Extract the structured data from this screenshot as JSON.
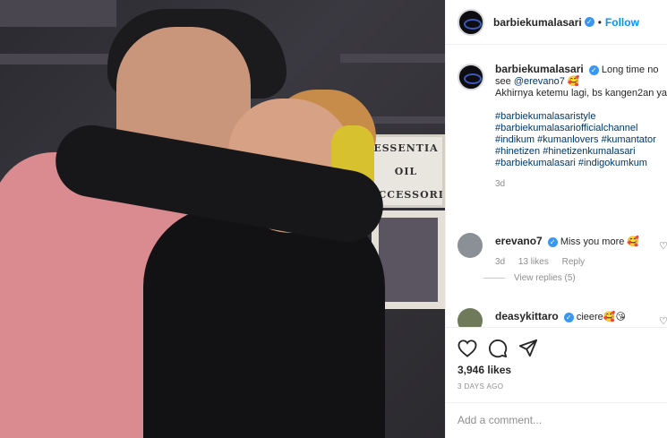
{
  "post": {
    "photo_sign_lines": [
      "ESSENTIA",
      "OIL",
      "ACCESSORI"
    ]
  },
  "header": {
    "username": "barbiekumalasari",
    "separator": "•",
    "follow_label": "Follow"
  },
  "caption": {
    "username": "barbiekumalasari",
    "text_line1": "Long time no see",
    "mention": "@erevano7",
    "emoji": "🥰",
    "text_line2": "Akhirnya ketemu lagi, bs kangen2an yaa",
    "hashtags": "#barbiekumalasaristyle #barbiekumalasariofficialchannel #indikum #kumanlovers #kumantator #hinetizen #hinetizenkumalasari #barbiekumalasari #indigokumkum",
    "time": "3d"
  },
  "comments": [
    {
      "username": "erevano7",
      "text": "Miss you more 🥰",
      "time": "3d",
      "likes": "13 likes",
      "reply_label": "Reply"
    },
    {
      "username": "deasykittaro",
      "text": "cieere🥰😘"
    }
  ],
  "view_replies_label": "View replies (5)",
  "likes_count": "3,946 likes",
  "posted_ago": "3 DAYS AGO",
  "add_comment_placeholder": "Add a comment...",
  "icons": [
    "heart-icon",
    "comment-icon",
    "share-icon",
    "verified-icon"
  ],
  "colors": {
    "link": "#00376b",
    "follow": "#0095f6",
    "verified": "#3897f0"
  }
}
